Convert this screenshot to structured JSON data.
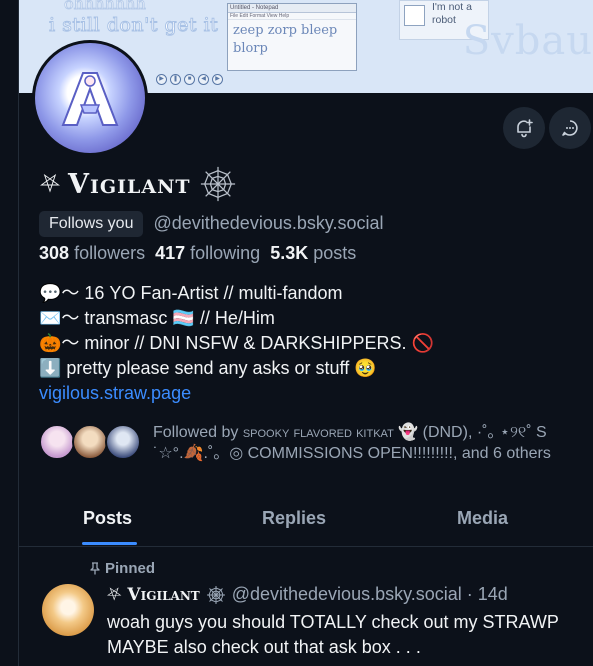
{
  "banner": {
    "deco_top": "ohhhhhhh",
    "deco_main": "i still don't get it",
    "deco_right": "Svbau",
    "window": {
      "title": "Untitled - Notepad",
      "menu": "File  Edit  Format  View  Help",
      "line1": "zeep zorp bleep",
      "line2": "blorp"
    },
    "captcha_label": "I'm not a robot"
  },
  "profile": {
    "name_prefix": "⛧",
    "name": "Vigilant",
    "follows_you": "Follows you",
    "handle": "@devithedevious.bsky.social",
    "followers_count": "308",
    "followers_label": "followers",
    "following_count": "417",
    "following_label": "following",
    "posts_count": "5.3K",
    "posts_label": "posts",
    "bio": [
      "💬〜 16 YO Fan-Artist // multi-fandom",
      "✉️〜 transmasc 🏳️‍⚧️ // He/Him",
      "🎃〜 minor // DNI NSFW & DARKSHIPPERS. 🚫",
      "⬇️ pretty please send any asks or stuff 🥹"
    ],
    "link": "vigilous.straw.page",
    "followed_by_prefix": "Followed by",
    "followed_by_name1": "spooky flavored kitkat",
    "followed_by_rest1": "👻 (DND), ·˚｡ ⋆୨୧˚ S",
    "followed_by_line2": "˙☆°.🍂.˚。◎ COMMISSIONS OPEN!!!!!!!!!, and 6 others"
  },
  "tabs": [
    {
      "label": "Posts"
    },
    {
      "label": "Replies"
    },
    {
      "label": "Media"
    }
  ],
  "post": {
    "pinned_label": "Pinned",
    "author_prefix": "⛧",
    "author": "Vigilant",
    "handle_time": "@devithedevious.bsky.social · 14d",
    "line1": "woah guys you should TOTALLY check out my STRAWP",
    "line2": "MAYBE also check out that ask box . . ."
  },
  "colors": {
    "background": "#0c111a",
    "accent": "#3b8cff",
    "muted_text": "#9aa6b5",
    "button_bg": "#1e2733"
  }
}
